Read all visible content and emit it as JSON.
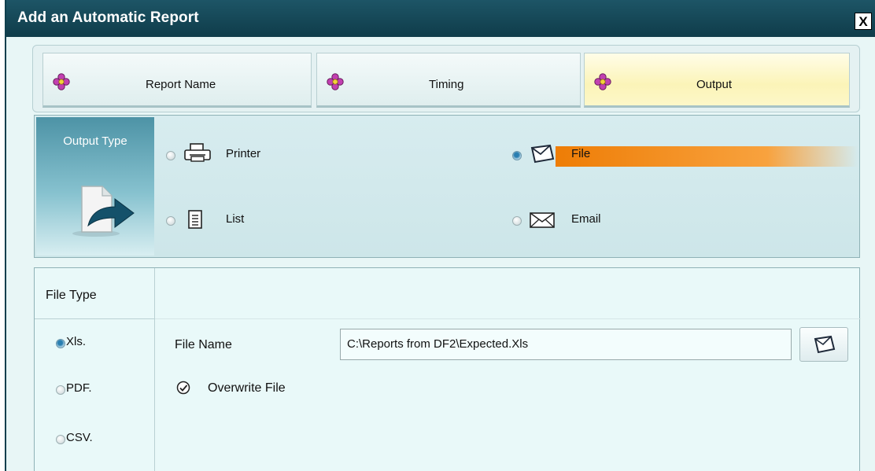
{
  "window": {
    "title": "Add an Automatic Report",
    "close_glyph": "X"
  },
  "tabs": [
    {
      "label": "Report Name",
      "icon": "flower-icon",
      "active": false
    },
    {
      "label": "Timing",
      "icon": "flower-icon",
      "active": false
    },
    {
      "label": "Output",
      "icon": "flower-icon",
      "active": true
    }
  ],
  "output_type": {
    "heading": "Output Type",
    "options": [
      {
        "label": "Printer",
        "icon": "printer-icon",
        "selected": false
      },
      {
        "label": "File",
        "icon": "folder-icon",
        "selected": true
      },
      {
        "label": "List",
        "icon": "list-icon",
        "selected": false
      },
      {
        "label": "Email",
        "icon": "envelope-icon",
        "selected": false
      }
    ],
    "highlight_color": "#f28a0e"
  },
  "file_type": {
    "heading": "File Type",
    "options": [
      {
        "label": "Xls.",
        "selected": true
      },
      {
        "label": "PDF.",
        "selected": false
      },
      {
        "label": "CSV.",
        "selected": false
      }
    ],
    "file_name_label": "File Name",
    "file_name_value": "C:\\Reports from DF2\\Expected.Xls",
    "overwrite_label": "Overwrite File",
    "overwrite_checked": true
  },
  "colors": {
    "titlebar": "#154857",
    "active_tab": "#fbf4b8",
    "panel_bg": "#d7ecef"
  }
}
